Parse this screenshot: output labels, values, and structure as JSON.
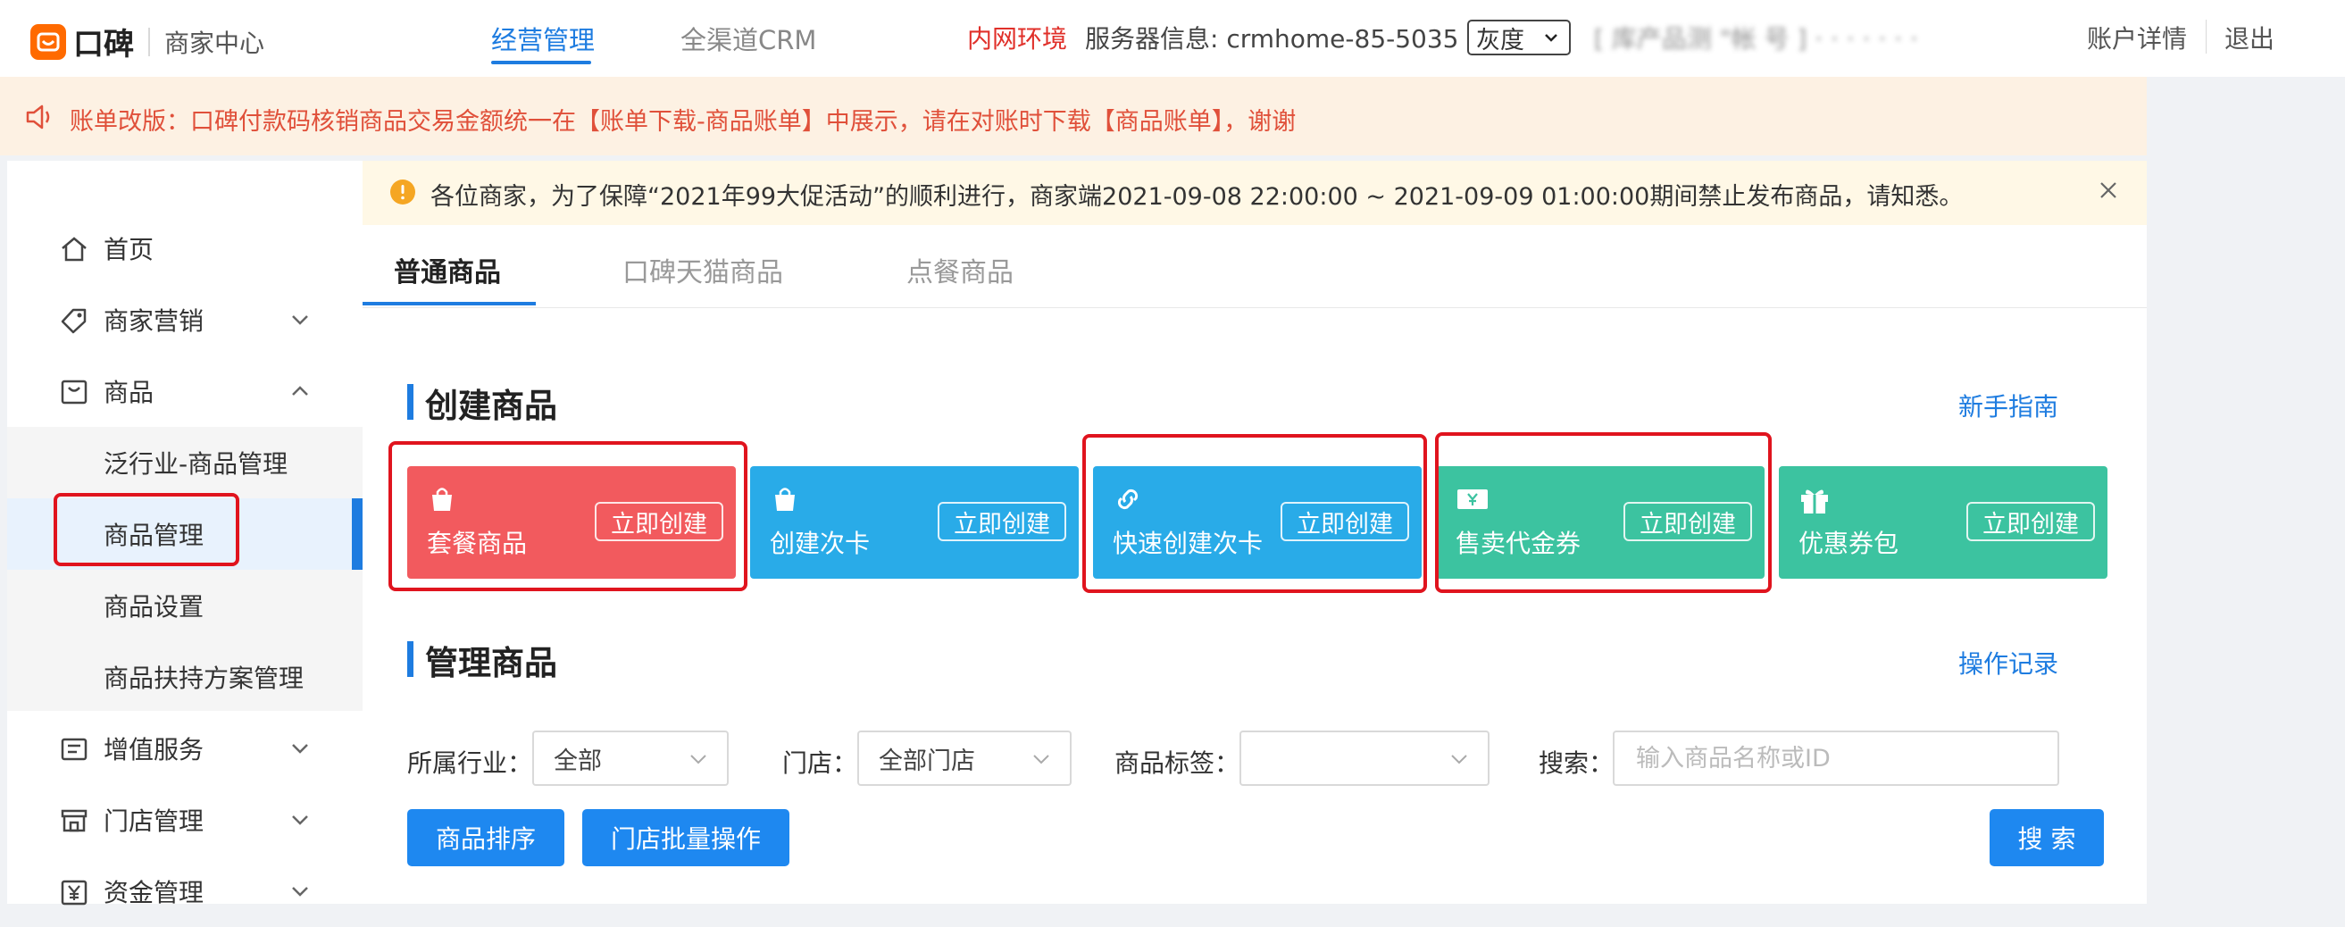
{
  "header": {
    "brand": "口碑",
    "subtitle": "商家中心",
    "nav": [
      "经营管理",
      "全渠道CRM"
    ],
    "env_label": "内网环境",
    "server_info": "服务器信息: crmhome-85-5035",
    "gray_select": "灰度",
    "blurred_text": "[ 库产品测 \"帐 号 ] · · · · · · ·",
    "account_label": "账户详情",
    "logout_label": "退出"
  },
  "notice": {
    "text": "账单改版：口碑付款码核销商品交易金额统一在【账单下载-商品账单】中展示，请在对账时下载【商品账单】，谢谢"
  },
  "alert": {
    "text": "各位商家，为了保障“2021年99大促活动”的顺利进行，商家端2021-09-08 22:00:00 ~ 2021-09-09 01:00:00期间禁止发布商品，请知悉。"
  },
  "sidebar": {
    "items": [
      {
        "label": "首页"
      },
      {
        "label": "商家营销"
      },
      {
        "label": "商品"
      },
      {
        "label": "泛行业-商品管理"
      },
      {
        "label": "商品管理"
      },
      {
        "label": "商品设置"
      },
      {
        "label": "商品扶持方案管理"
      },
      {
        "label": "增值服务"
      },
      {
        "label": "门店管理"
      },
      {
        "label": "资金管理"
      }
    ]
  },
  "tabs": [
    "普通商品",
    "口碑天猫商品",
    "点餐商品"
  ],
  "create_section": {
    "title": "创建商品",
    "guide_link": "新手指南",
    "cards": [
      {
        "label": "套餐商品",
        "button": "立即创建",
        "color": "#f25a5e"
      },
      {
        "label": "创建次卡",
        "button": "立即创建",
        "color": "#29abe8"
      },
      {
        "label": "快速创建次卡",
        "button": "立即创建",
        "color": "#29abe8"
      },
      {
        "label": "售卖代金券",
        "button": "立即创建",
        "color": "#3cc3a0"
      },
      {
        "label": "优惠券包",
        "button": "立即创建",
        "color": "#3cc3a0"
      }
    ]
  },
  "manage_section": {
    "title": "管理商品",
    "log_link": "操作记录",
    "filters": {
      "industry_label": "所属行业：",
      "industry_value": "全部",
      "store_label": "门店：",
      "store_value": "全部门店",
      "tag_label": "商品标签：",
      "tag_value": "",
      "search_label": "搜索：",
      "search_placeholder": "输入商品名称或ID"
    },
    "buttons": {
      "sort": "商品排序",
      "batch": "门店批量操作",
      "search": "搜 索"
    }
  }
}
